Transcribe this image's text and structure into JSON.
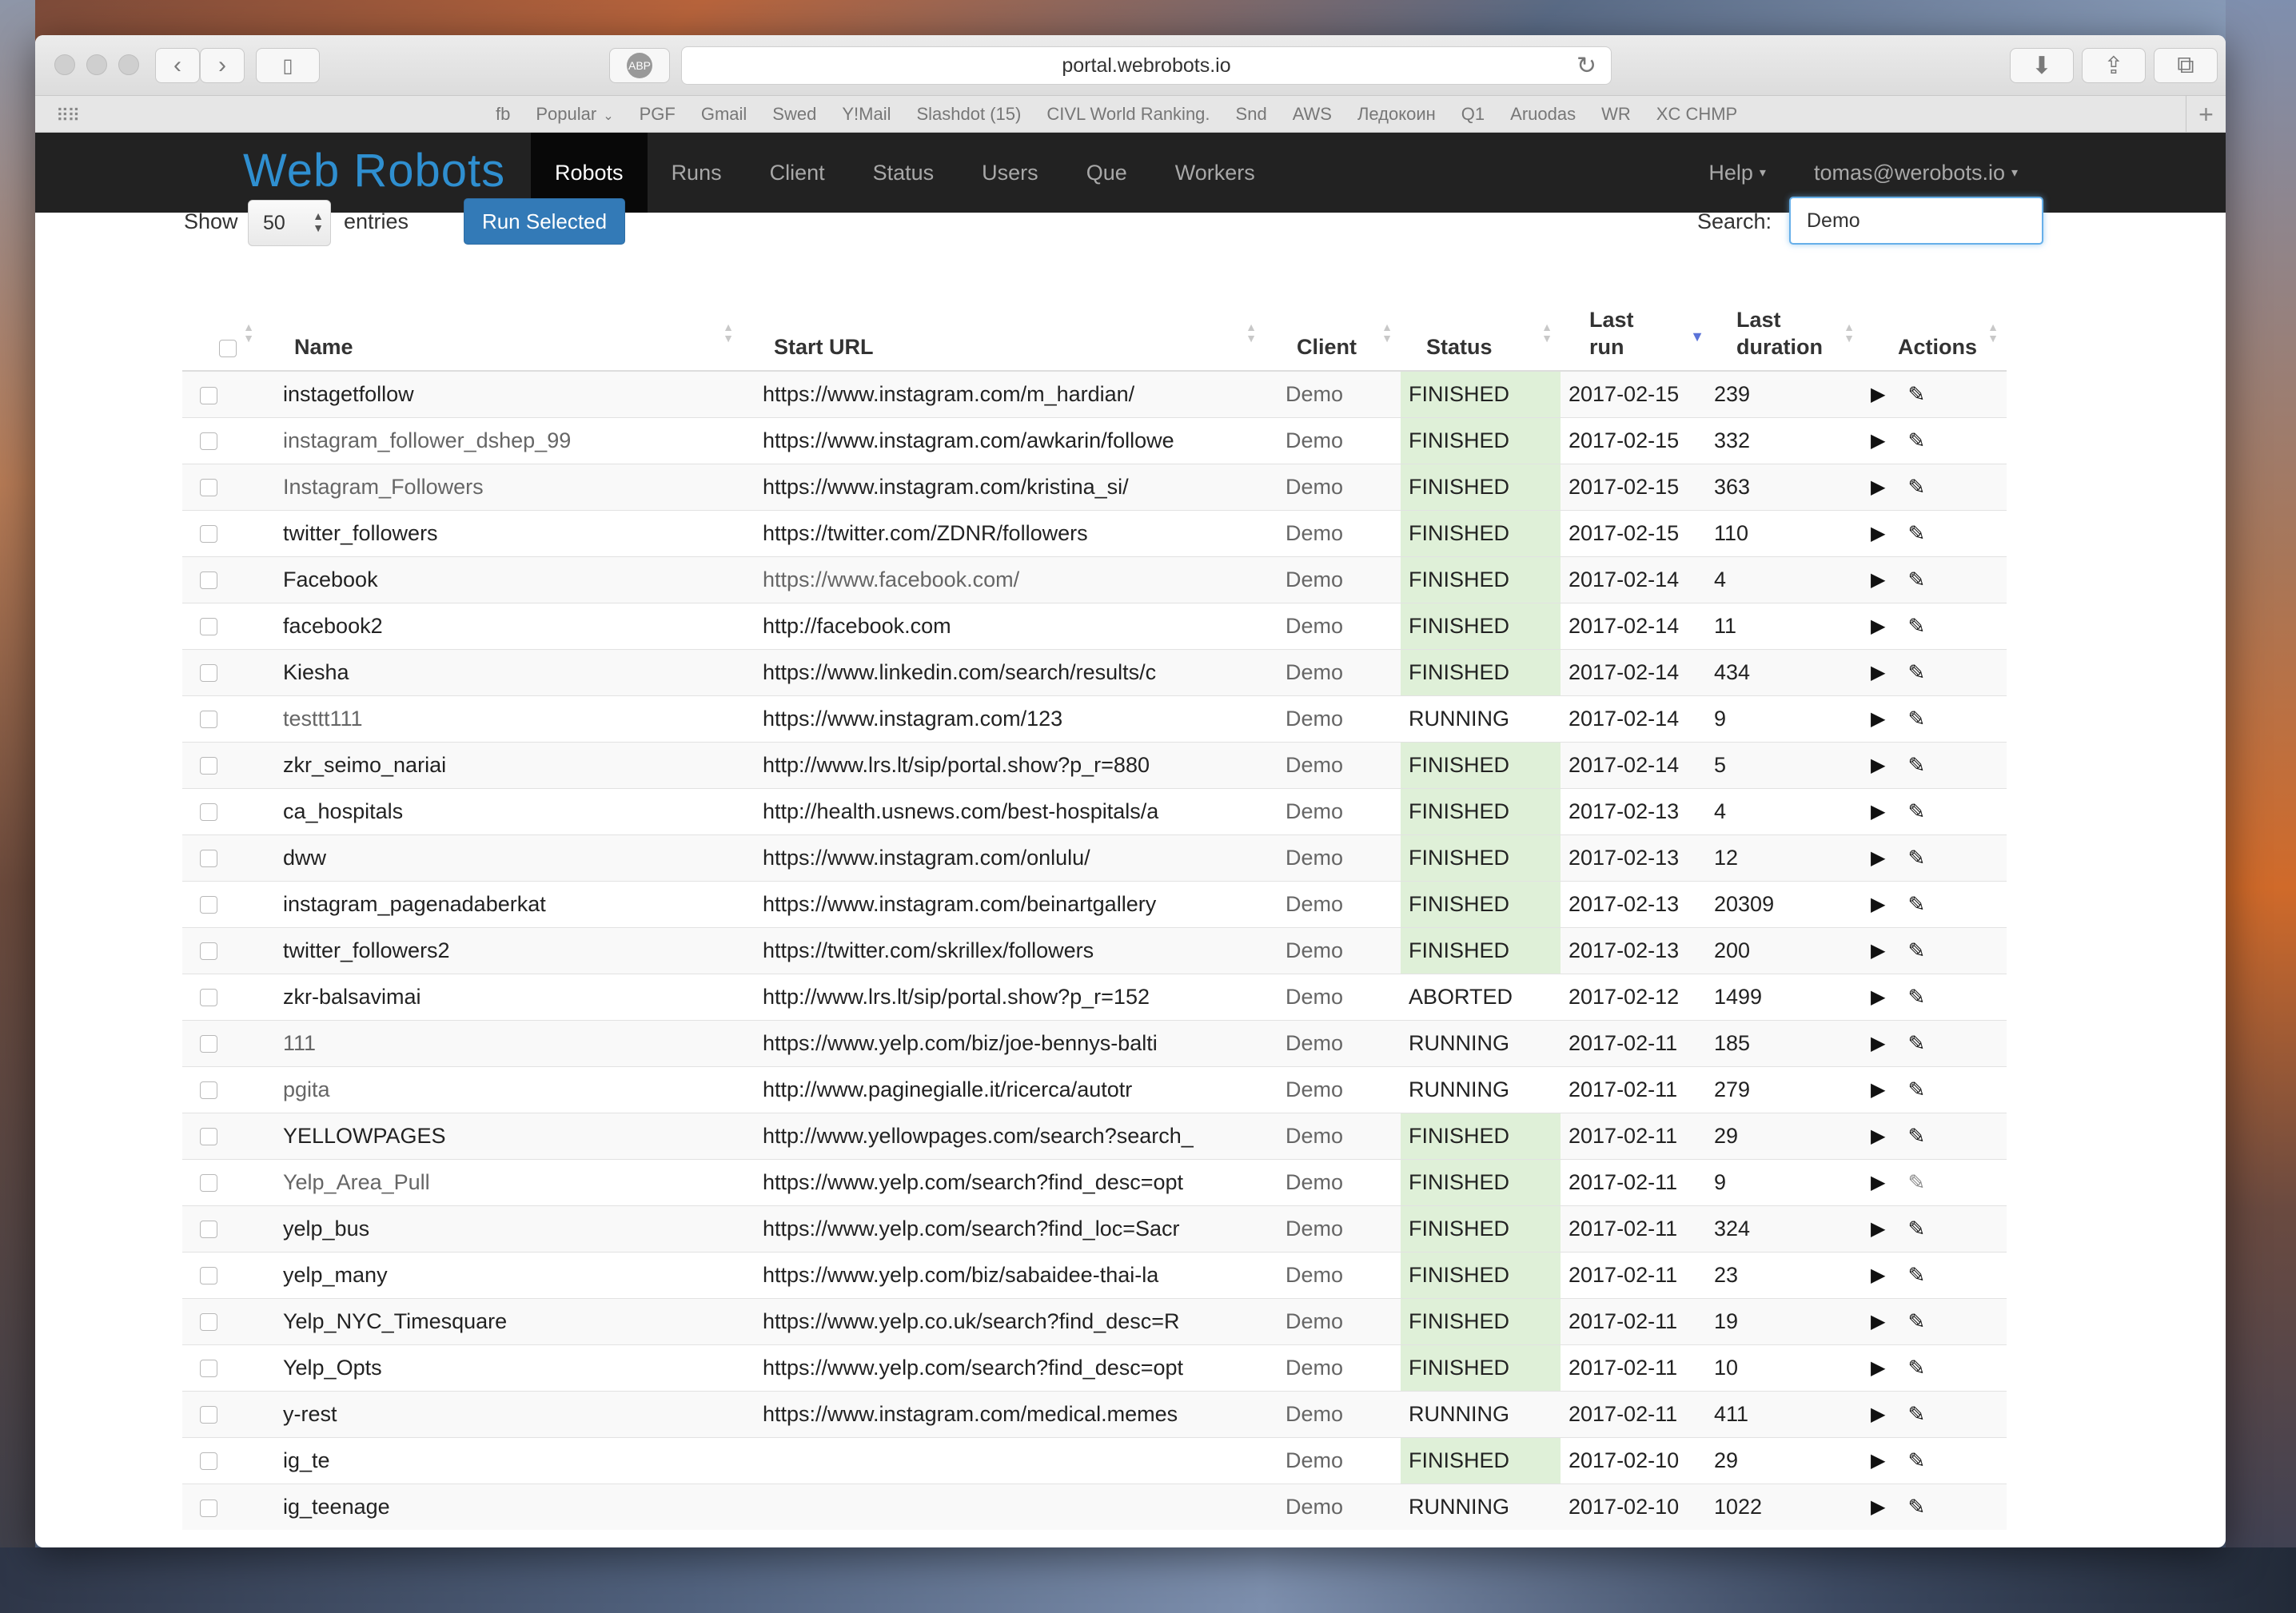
{
  "browser": {
    "url": "portal.webrobots.io",
    "bookmarks": [
      "fb",
      "Popular",
      "PGF",
      "Gmail",
      "Swed",
      "Y!Mail",
      "Slashdot (15)",
      "CIVL World Ranking.",
      "Snd",
      "AWS",
      "Ледокоин",
      "Q1",
      "Aruodas",
      "WR",
      "XC CHMP"
    ]
  },
  "navbar": {
    "brand": "Web Robots",
    "items": [
      "Robots",
      "Runs",
      "Client",
      "Status",
      "Users",
      "Que",
      "Workers"
    ],
    "active": "Robots",
    "help": "Help",
    "user": "tomas@werobots.io"
  },
  "controls": {
    "show_label": "Show",
    "entries_value": "50",
    "entries_label": "entries",
    "run_button": "Run Selected",
    "search_label": "Search:",
    "search_value": "Demo"
  },
  "table": {
    "headers": {
      "name": "Name",
      "start_url": "Start URL",
      "client": "Client",
      "status": "Status",
      "last_run": "Last run",
      "last_duration": "Last duration",
      "actions": "Actions"
    },
    "rows": [
      {
        "name": "instagetfollow",
        "url": "https://www.instagram.com/m_hardian/",
        "client": "Demo",
        "status": "FINISHED",
        "last_run": "2017-02-15",
        "duration": "239"
      },
      {
        "name": "instagram_follower_dshep_99",
        "url": "https://www.instagram.com/awkarin/followe",
        "client": "Demo",
        "status": "FINISHED",
        "last_run": "2017-02-15",
        "duration": "332",
        "muted_name": true
      },
      {
        "name": "Instagram_Followers",
        "url": "https://www.instagram.com/kristina_si/",
        "client": "Demo",
        "status": "FINISHED",
        "last_run": "2017-02-15",
        "duration": "363",
        "muted_name": true
      },
      {
        "name": "twitter_followers",
        "url": "https://twitter.com/ZDNR/followers",
        "client": "Demo",
        "status": "FINISHED",
        "last_run": "2017-02-15",
        "duration": "110"
      },
      {
        "name": "Facebook",
        "url": "https://www.facebook.com/",
        "client": "Demo",
        "status": "FINISHED",
        "last_run": "2017-02-14",
        "duration": "4",
        "muted_url": true
      },
      {
        "name": "facebook2",
        "url": "http://facebook.com",
        "client": "Demo",
        "status": "FINISHED",
        "last_run": "2017-02-14",
        "duration": "11"
      },
      {
        "name": "Kiesha",
        "url": "https://www.linkedin.com/search/results/c",
        "client": "Demo",
        "status": "FINISHED",
        "last_run": "2017-02-14",
        "duration": "434"
      },
      {
        "name": "testtt111",
        "url": "https://www.instagram.com/123",
        "client": "Demo",
        "status": "RUNNING",
        "last_run": "2017-02-14",
        "duration": "9",
        "muted_name": true
      },
      {
        "name": "zkr_seimo_nariai",
        "url": "http://www.lrs.lt/sip/portal.show?p_r=880",
        "client": "Demo",
        "status": "FINISHED",
        "last_run": "2017-02-14",
        "duration": "5"
      },
      {
        "name": "ca_hospitals",
        "url": "http://health.usnews.com/best-hospitals/a",
        "client": "Demo",
        "status": "FINISHED",
        "last_run": "2017-02-13",
        "duration": "4"
      },
      {
        "name": "dww",
        "url": "https://www.instagram.com/onlulu/",
        "client": "Demo",
        "status": "FINISHED",
        "last_run": "2017-02-13",
        "duration": "12"
      },
      {
        "name": "instagram_pagenadaberkat",
        "url": "https://www.instagram.com/beinartgallery",
        "client": "Demo",
        "status": "FINISHED",
        "last_run": "2017-02-13",
        "duration": "20309"
      },
      {
        "name": "twitter_followers2",
        "url": "https://twitter.com/skrillex/followers",
        "client": "Demo",
        "status": "FINISHED",
        "last_run": "2017-02-13",
        "duration": "200"
      },
      {
        "name": "zkr-balsavimai",
        "url": "http://www.lrs.lt/sip/portal.show?p_r=152",
        "client": "Demo",
        "status": "ABORTED",
        "last_run": "2017-02-12",
        "duration": "1499"
      },
      {
        "name": "111",
        "url": "https://www.yelp.com/biz/joe-bennys-balti",
        "client": "Demo",
        "status": "RUNNING",
        "last_run": "2017-02-11",
        "duration": "185",
        "muted_name": true
      },
      {
        "name": "pgita",
        "url": "http://www.paginegialle.it/ricerca/autotr",
        "client": "Demo",
        "status": "RUNNING",
        "last_run": "2017-02-11",
        "duration": "279",
        "muted_name": true
      },
      {
        "name": "YELLOWPAGES",
        "url": "http://www.yellowpages.com/search?search_",
        "client": "Demo",
        "status": "FINISHED",
        "last_run": "2017-02-11",
        "duration": "29"
      },
      {
        "name": "Yelp_Area_Pull",
        "url": "https://www.yelp.com/search?find_desc=opt",
        "client": "Demo",
        "status": "FINISHED",
        "last_run": "2017-02-11",
        "duration": "9",
        "muted_name": true,
        "dim_edit": true
      },
      {
        "name": "yelp_bus",
        "url": "https://www.yelp.com/search?find_loc=Sacr",
        "client": "Demo",
        "status": "FINISHED",
        "last_run": "2017-02-11",
        "duration": "324"
      },
      {
        "name": "yelp_many",
        "url": "https://www.yelp.com/biz/sabaidee-thai-la",
        "client": "Demo",
        "status": "FINISHED",
        "last_run": "2017-02-11",
        "duration": "23"
      },
      {
        "name": "Yelp_NYC_Timesquare",
        "url": "https://www.yelp.co.uk/search?find_desc=R",
        "client": "Demo",
        "status": "FINISHED",
        "last_run": "2017-02-11",
        "duration": "19"
      },
      {
        "name": "Yelp_Opts",
        "url": "https://www.yelp.com/search?find_desc=opt",
        "client": "Demo",
        "status": "FINISHED",
        "last_run": "2017-02-11",
        "duration": "10"
      },
      {
        "name": "y-rest",
        "url": "https://www.instagram.com/medical.memes",
        "client": "Demo",
        "status": "RUNNING",
        "last_run": "2017-02-11",
        "duration": "411"
      },
      {
        "name": "ig_te",
        "url": "",
        "client": "Demo",
        "status": "FINISHED",
        "last_run": "2017-02-10",
        "duration": "29"
      },
      {
        "name": "ig_teenage",
        "url": "",
        "client": "Demo",
        "status": "RUNNING",
        "last_run": "2017-02-10",
        "duration": "1022"
      }
    ]
  },
  "colors": {
    "navbar_bg": "#222222",
    "brand": "#2f8fd0",
    "primary_button": "#337ab7",
    "finished_bg": "#dff0d8",
    "sort_active": "#5b73d8"
  }
}
